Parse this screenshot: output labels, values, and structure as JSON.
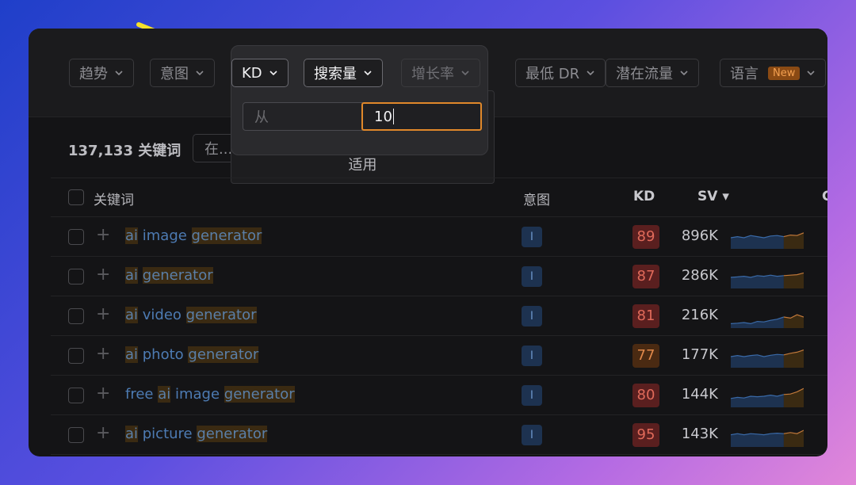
{
  "filters": [
    {
      "label": "趋势",
      "name": "filter-trend"
    },
    {
      "label": "意图",
      "name": "filter-intent"
    },
    {
      "label": "KD",
      "name": "filter-kd"
    },
    {
      "label": "搜索量",
      "name": "filter-volume"
    },
    {
      "label": "增长率",
      "name": "filter-growth"
    },
    {
      "label": "最低 DR",
      "name": "filter-min-dr"
    },
    {
      "label": "潜在流量",
      "name": "filter-traffic"
    },
    {
      "label": "语言",
      "name": "filter-language"
    }
  ],
  "language_badge": "New",
  "kd_popover": {
    "from_placeholder": "从",
    "to_value": "10",
    "apply_label": "适用"
  },
  "summary": {
    "count_text": "137,133 关键词",
    "search_placeholder": "在..."
  },
  "table": {
    "headers": {
      "keyword": "关键词",
      "intent": "意图",
      "kd": "KD",
      "sv": "SV ▾",
      "cut": "C"
    },
    "rows": [
      {
        "parts": [
          [
            "ai",
            true
          ],
          [
            " image ",
            false
          ],
          [
            "generator",
            true
          ]
        ],
        "intent": "I",
        "kd": "89",
        "sv": "896K"
      },
      {
        "parts": [
          [
            "ai",
            true
          ],
          [
            " ",
            false
          ],
          [
            "generator",
            true
          ]
        ],
        "intent": "I",
        "kd": "87",
        "sv": "286K"
      },
      {
        "parts": [
          [
            "ai",
            true
          ],
          [
            " video ",
            false
          ],
          [
            "generator",
            true
          ]
        ],
        "intent": "I",
        "kd": "81",
        "sv": "216K"
      },
      {
        "parts": [
          [
            "ai",
            true
          ],
          [
            " photo ",
            false
          ],
          [
            "generator",
            true
          ]
        ],
        "intent": "I",
        "kd": "77",
        "sv": "177K"
      },
      {
        "parts": [
          [
            "free ",
            false
          ],
          [
            "ai",
            true
          ],
          [
            " image ",
            false
          ],
          [
            "generator",
            true
          ]
        ],
        "intent": "I",
        "kd": "80",
        "sv": "144K"
      },
      {
        "parts": [
          [
            "ai",
            true
          ],
          [
            " picture ",
            false
          ],
          [
            "generator",
            true
          ]
        ],
        "intent": "I",
        "kd": "95",
        "sv": "143K"
      }
    ]
  },
  "colors": {
    "kd_red": "#5a1f1f",
    "kd_red_text": "#e06a5a",
    "kd_orange": "#4a2a12",
    "kd_orange_text": "#e0884a",
    "arrow": "#f5e12a"
  }
}
